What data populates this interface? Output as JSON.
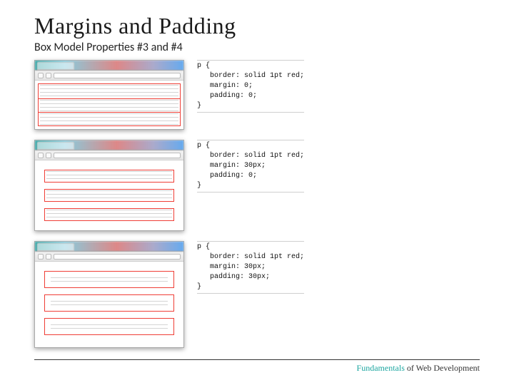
{
  "title": "Margins and Padding",
  "subtitle": "Box Model Properties #3 and #4",
  "examples": [
    {
      "code": {
        "selector": "p {",
        "border": "border: solid 1pt red;",
        "margin": "margin: 0;",
        "padding": "padding: 0;",
        "close": "}"
      }
    },
    {
      "code": {
        "selector": "p {",
        "border": "border: solid 1pt red;",
        "margin": "margin: 30px;",
        "padding": "padding: 0;",
        "close": "}"
      }
    },
    {
      "code": {
        "selector": "p {",
        "border": "border: solid 1pt red;",
        "margin": "margin: 30px;",
        "padding": "padding: 30px;",
        "close": "}"
      }
    }
  ],
  "footer": {
    "left": "Fundamentals",
    "right": " of Web Development"
  }
}
